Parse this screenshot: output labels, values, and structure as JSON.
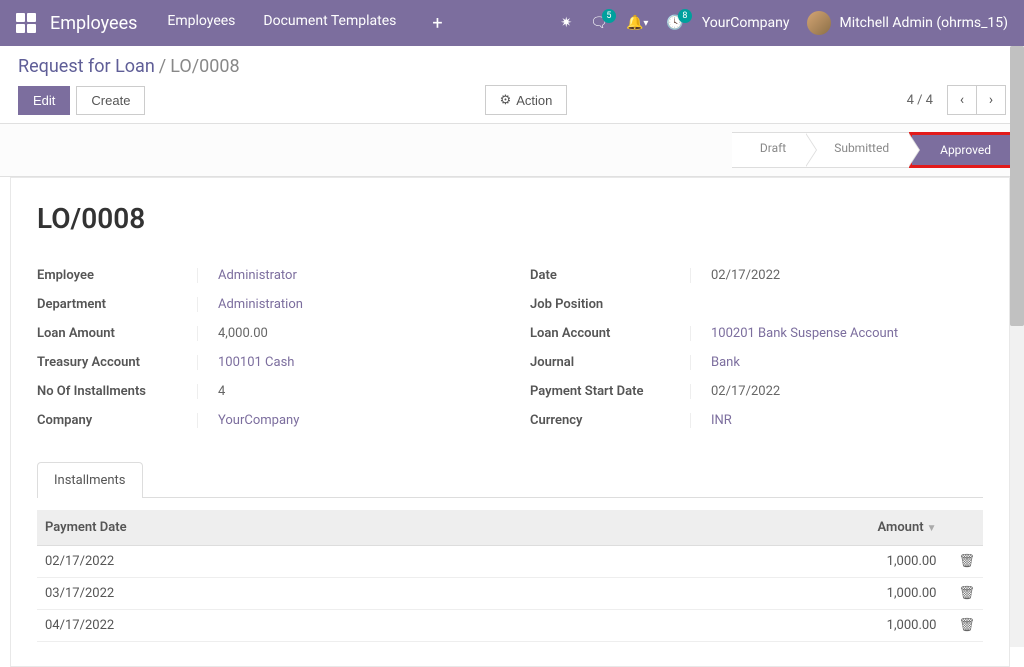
{
  "navbar": {
    "app_name": "Employees",
    "menu": [
      "Employees",
      "Document Templates"
    ],
    "messages_count": "5",
    "activities_count": "8",
    "company": "YourCompany",
    "user": "Mitchell Admin (ohrms_15)"
  },
  "breadcrumb": {
    "parent": "Request for Loan",
    "current": "LO/0008"
  },
  "controls": {
    "edit": "Edit",
    "create": "Create",
    "action": "Action",
    "pager": "4 / 4"
  },
  "status": {
    "items": [
      "Draft",
      "Submitted",
      "Approved"
    ],
    "active": "Approved"
  },
  "form": {
    "title": "LO/0008",
    "left": {
      "employee_label": "Employee",
      "employee_value": "Administrator",
      "department_label": "Department",
      "department_value": "Administration",
      "loan_amount_label": "Loan Amount",
      "loan_amount_value": "4,000.00",
      "treasury_label": "Treasury Account",
      "treasury_value": "100101 Cash",
      "installments_label": "No Of Installments",
      "installments_value": "4",
      "company_label": "Company",
      "company_value": "YourCompany"
    },
    "right": {
      "date_label": "Date",
      "date_value": "02/17/2022",
      "job_label": "Job Position",
      "job_value": "",
      "loan_account_label": "Loan Account",
      "loan_account_value": "100201 Bank Suspense Account",
      "journal_label": "Journal",
      "journal_value": "Bank",
      "pay_start_label": "Payment Start Date",
      "pay_start_value": "02/17/2022",
      "currency_label": "Currency",
      "currency_value": "INR"
    }
  },
  "tabs": {
    "installments": "Installments"
  },
  "table": {
    "col_date": "Payment Date",
    "col_amount": "Amount",
    "rows": [
      {
        "date": "02/17/2022",
        "amount": "1,000.00"
      },
      {
        "date": "03/17/2022",
        "amount": "1,000.00"
      },
      {
        "date": "04/17/2022",
        "amount": "1,000.00"
      }
    ]
  }
}
